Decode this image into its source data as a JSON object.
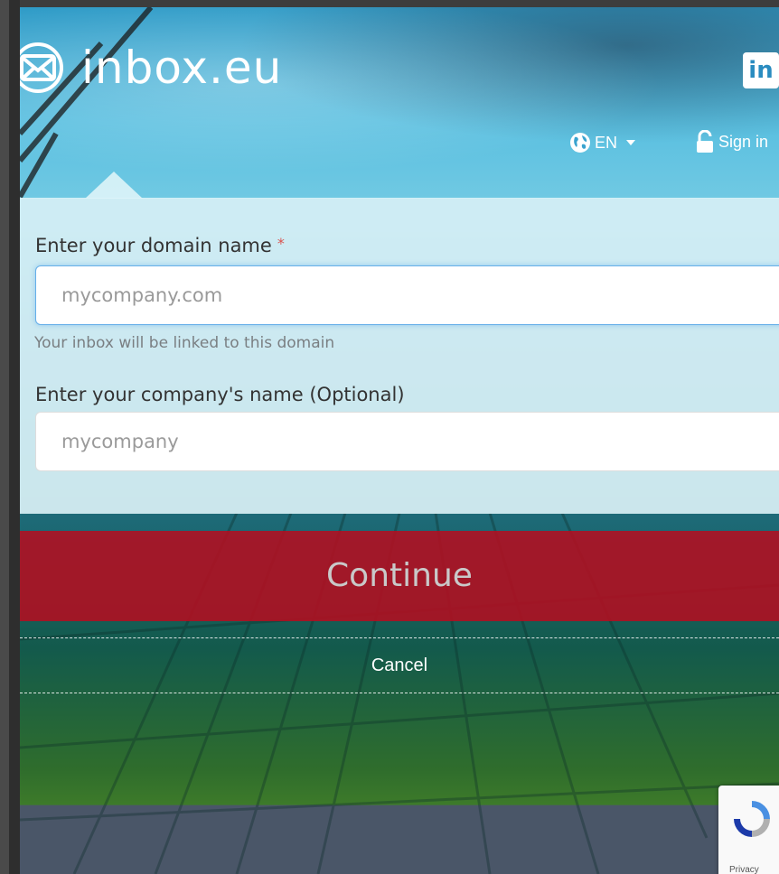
{
  "header": {
    "logo_text": "inbox.eu",
    "linkedin_label": "in",
    "language": "EN",
    "signin_label": "Sign in"
  },
  "form": {
    "domain_label": "Enter your domain name",
    "domain_required_mark": "*",
    "domain_placeholder": "mycompany.com",
    "domain_help": "Your inbox will be linked to this domain",
    "company_label": "Enter your company's name (Optional)",
    "company_placeholder": "mycompany"
  },
  "actions": {
    "continue_label": "Continue",
    "cancel_label": "Cancel"
  },
  "recaptcha": {
    "privacy_label": "Privacy"
  },
  "colors": {
    "continue_bg": "#b40e20",
    "panel_bg": "#def4f8",
    "input_focus": "#66afe9",
    "required": "#d9534f"
  },
  "icons": [
    "envelope-logo-icon",
    "linkedin-icon",
    "globe-icon",
    "chevron-down-icon",
    "lock-open-icon",
    "recaptcha-icon"
  ]
}
